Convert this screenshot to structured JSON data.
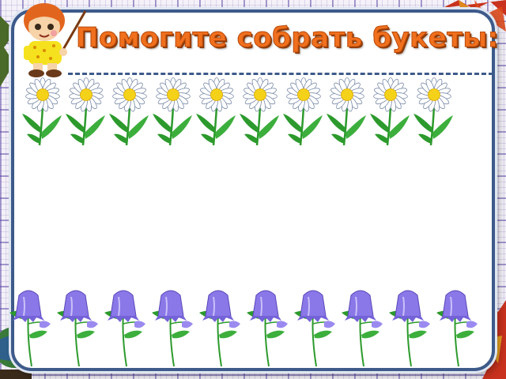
{
  "title": "Помогите собрать букеты:",
  "daisies": {
    "count": 10,
    "petal_color": "#ffffff",
    "center_color": "#f5d21a",
    "stem_color": "#2c9a2c"
  },
  "bellflowers": {
    "count": 10,
    "flower_color": "#8a78e8",
    "stem_color": "#2c9a2c"
  },
  "colors": {
    "title": "#f0701e",
    "board_border": "#3d5a8a",
    "grid": "#5a44a8"
  }
}
